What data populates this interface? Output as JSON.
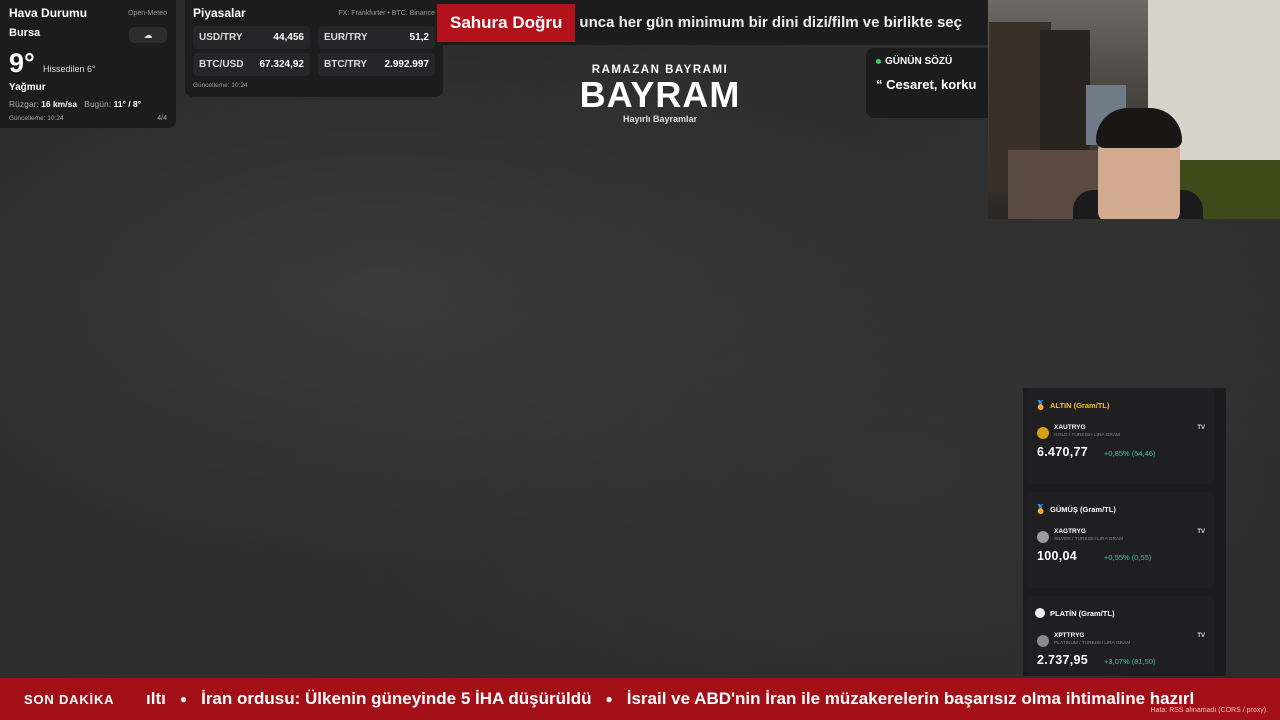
{
  "weather": {
    "title": "Hava Durumu",
    "source": "Open-Meteo",
    "city": "Bursa",
    "cloud_icon": "☁",
    "temperature": "9°",
    "feels_like": "Hissedilen 6°",
    "condition": "Yağmur",
    "wind_label": "Rüzgar:",
    "wind_value": "16 km/sa",
    "today_label": "Bugün:",
    "today_value": "11° / 8°",
    "updated": "Güncelleme: 10:24",
    "page": "4/4"
  },
  "markets": {
    "title": "Piyasalar",
    "source": "FX: Frankfurter • BTC: Binance",
    "items": [
      {
        "label": "USD/TRY",
        "value": "44,456"
      },
      {
        "label": "EUR/TRY",
        "value": "51,2"
      },
      {
        "label": "BTC/USD",
        "value": "67.324,92"
      },
      {
        "label": "BTC/TRY",
        "value": "2.992.997"
      }
    ],
    "updated": "Güncelleme: 10:24"
  },
  "sahur": {
    "label": "Sahura Doğru",
    "text": "unca her gün minimum bir dini dizi/film ve birlikte seç"
  },
  "center": {
    "subtitle": "RAMAZAN BAYRAMI",
    "title": "BAYRAM",
    "tagline": "Hayırlı Bayramlar"
  },
  "quote": {
    "title": "GÜNÜN SÖZÜ",
    "text": "“ Cesaret, korku"
  },
  "metals": [
    {
      "title": "ALTIN (Gram/TL)",
      "title_color": "#f0c419",
      "icon": "medal-gold",
      "symbol": "XAUTRYG",
      "desc": "GOLD / TURKISH LIRA GRAM",
      "price": "6.470,77",
      "change": "+0,85% (54,46)",
      "coin_color": "#d4a017"
    },
    {
      "title": "GÜMÜŞ (Gram/TL)",
      "title_color": "#ffffff",
      "icon": "medal-silver",
      "symbol": "XAGTRYG",
      "desc": "SILVER / TURKISH LIRA GRAM",
      "price": "100,04",
      "change": "+0,55% (0,55)",
      "coin_color": "#9a9a9a"
    },
    {
      "title": "PLATİN (Gram/TL)",
      "title_color": "#ffffff",
      "icon": "circle-white",
      "symbol": "XPTTRYG",
      "desc": "PLATINUM / TURKISH LIRA GRAM",
      "price": "2.737,95",
      "change": "+3,07% (81,50)",
      "coin_color": "#8a8a8a"
    }
  ],
  "tradingview_label": "TV",
  "breaking": {
    "label": "SON DAKİKA",
    "items": [
      "ıltı",
      "İran ordusu: Ülkenin güneyinde 5 İHA düşürüldü",
      "İsrail ve ABD'nin İran ile müzakerelerin başarısız olma ihtimaline hazırl"
    ],
    "error": "Hata: RSS alınamadı (CORS / proxy)."
  }
}
